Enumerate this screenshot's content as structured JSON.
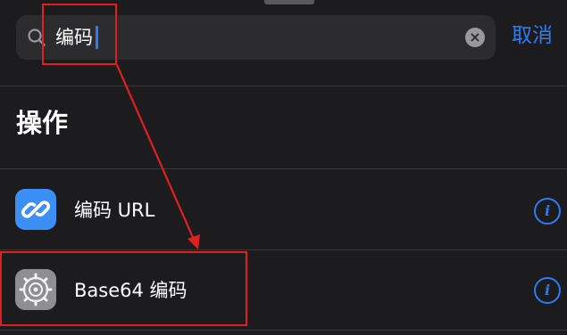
{
  "search": {
    "query": "编码",
    "cancel_label": "取消"
  },
  "section": {
    "title": "操作"
  },
  "actions": [
    {
      "label": "编码 URL",
      "icon": "link-icon"
    },
    {
      "label": "Base64 编码",
      "icon": "gear-icon"
    }
  ],
  "colors": {
    "accent": "#2f7bf6",
    "background": "#1c1c1e",
    "search_field": "#2c2c2e",
    "annotation": "#e02020"
  }
}
